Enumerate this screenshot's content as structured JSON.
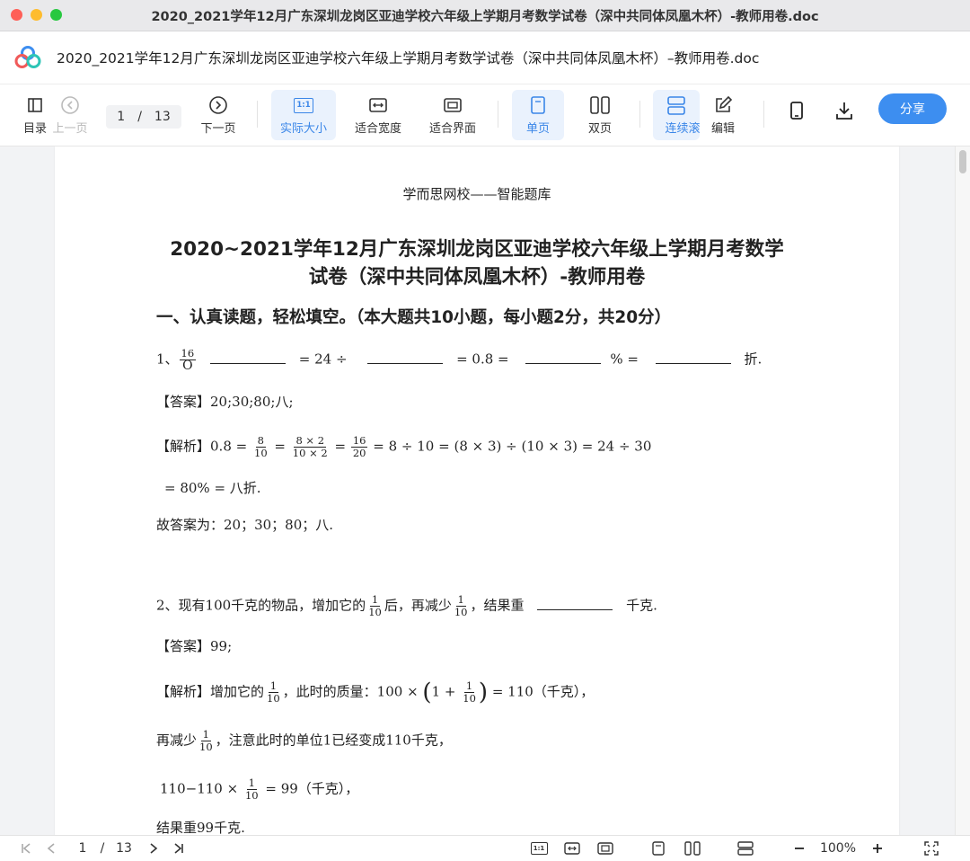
{
  "window": {
    "title": "2020_2021学年12月广东深圳龙岗区亚迪学校六年级上学期月考数学试卷（深中共同体凤凰木杯）-教师用卷.doc"
  },
  "header": {
    "doc_title": "2020_2021学年12月广东深圳龙岗区亚迪学校六年级上学期月考数学试卷（深中共同体凤凰木杯）–教师用卷.doc"
  },
  "toolbar": {
    "toc": "目录",
    "prev": "上一页",
    "page_current": "1",
    "page_sep": "/",
    "page_total": "13",
    "next": "下一页",
    "actual_size": "实际大小",
    "actual_icon_text": "1:1",
    "fit_width": "适合宽度",
    "fit_page": "适合界面",
    "single": "单页",
    "double": "双页",
    "continuous": "连续滚",
    "edit": "编辑",
    "share": "分享",
    "accent": "#3d8ef0"
  },
  "document": {
    "header": "学而思网校——智能题库",
    "title_line1": "2020~2021学年12月广东深圳龙岗区亚迪学校六年级上学期月考数学",
    "title_line2": "试卷（深中共同体凤凰木杯）-教师用卷",
    "section1": "一、认真读题，轻松填空。（本大题共10小题，每小题2分，共20分）",
    "q1": {
      "num": "1、",
      "frac_num": "16",
      "frac_den": "O",
      "eq1": "= 24 ÷",
      "eq2": "= 0.8 =",
      "pct": "% =",
      "end": "折.",
      "answer_label": "【答案】",
      "answer": "20;30;80;八;",
      "analysis_label": "【解析】",
      "a1": "0.8 =",
      "f1n": "8",
      "f1d": "10",
      "eqs": "=",
      "f2n": "8 × 2",
      "f2d": "10 × 2",
      "f3n": "16",
      "f3d": "20",
      "a2": "= 8 ÷ 10 =",
      "a3": "8 × 3",
      "a4": "÷",
      "a5": "10 × 3",
      "a6": "= 24 ÷ 30",
      "line2": "= 80% = 八折.",
      "conclusion": "故答案为：20；30；80；八."
    },
    "q2": {
      "p1": "2、现有100千克的物品，增加它的",
      "fn": "1",
      "fd": "10",
      "p2": "后，再减少",
      "p3": "，结果重",
      "p4": "千克.",
      "answer_label": "【答案】",
      "answer": "99;",
      "analysis_label": "【解析】",
      "b1": "增加它的",
      "b2": "，此时的质量：100 ×",
      "b3": "1 +",
      "b4": "= 110（千克），",
      "c1": "再减少",
      "c2": "，注意此时的单位1已经变成110千克，",
      "d1": "110−110 ×",
      "d2": "= 99（千克），",
      "e1": "结果重99千克."
    }
  },
  "bottom": {
    "page_current": "1",
    "page_sep": "/",
    "page_total": "13",
    "zoom": "100%",
    "actual_icon_text": "1:1"
  }
}
